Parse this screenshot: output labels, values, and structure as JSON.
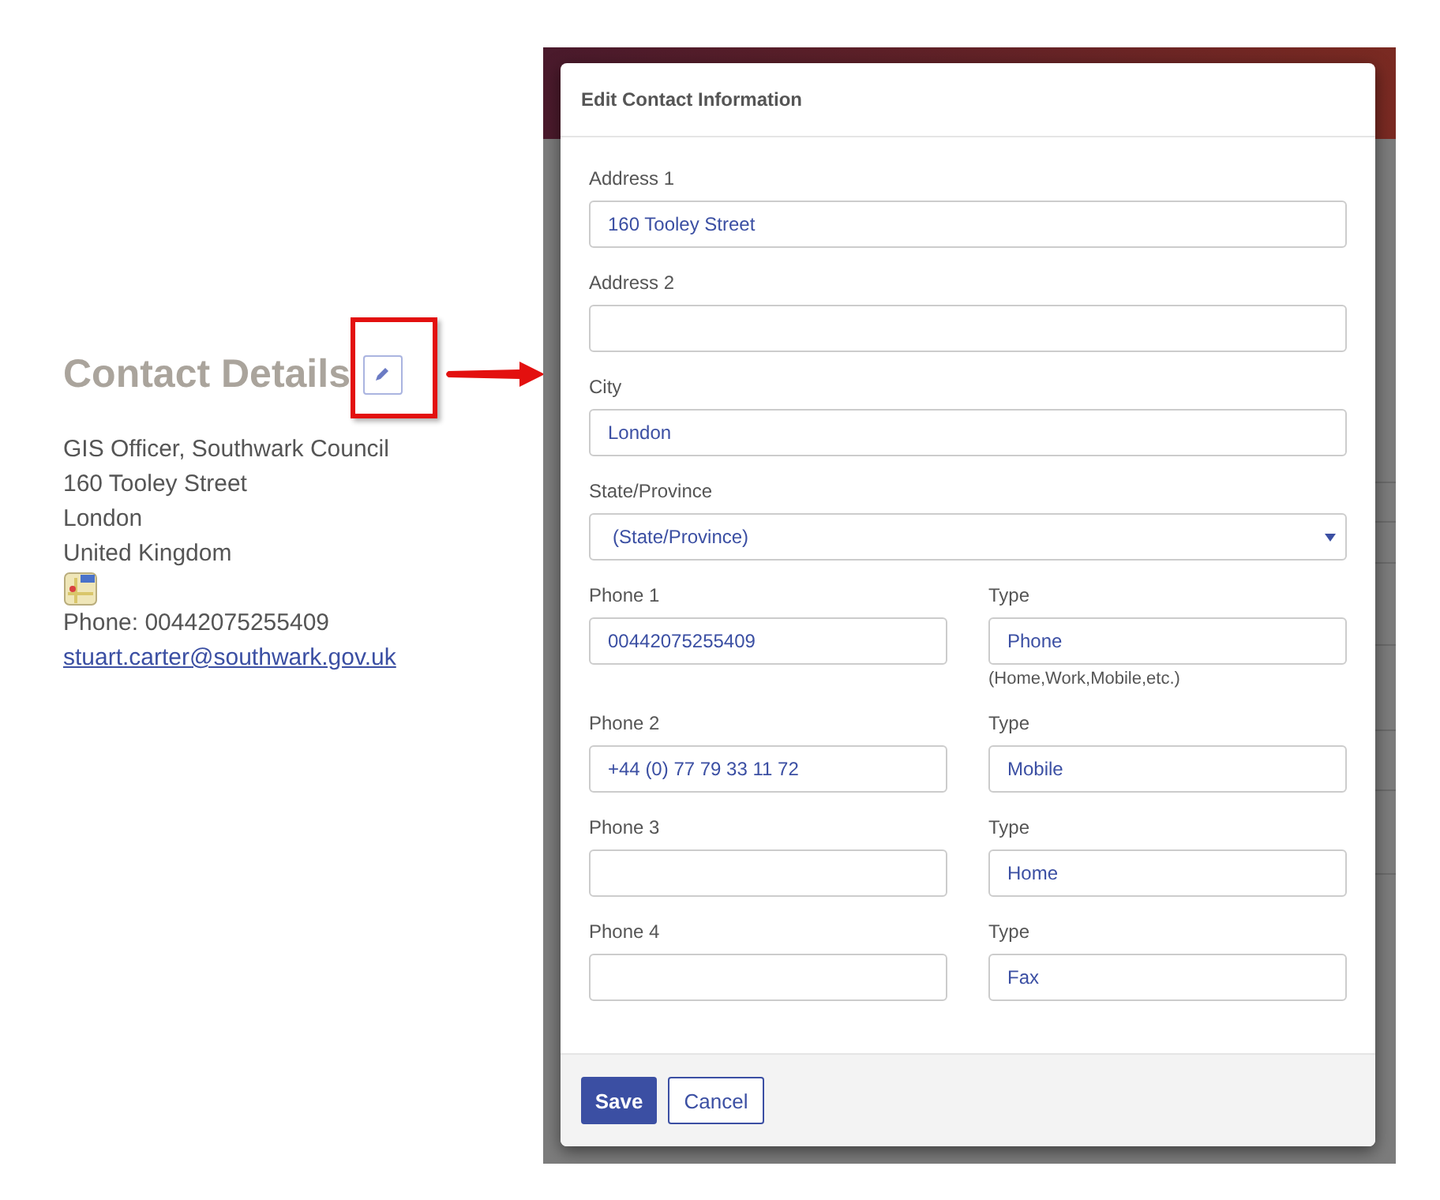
{
  "contact_details": {
    "title": "Contact Details",
    "lines": [
      "GIS Officer, Southwark Council",
      "160 Tooley Street",
      "London",
      "United Kingdom"
    ],
    "phone": "Phone: 00442075255409",
    "email": "stuart.carter@southwark.gov.uk"
  },
  "dialog": {
    "title": "Edit Contact Information",
    "rows": [
      [
        {
          "label": "Address 1",
          "kind": "text",
          "value": "160 Tooley Street"
        }
      ],
      [
        {
          "label": "Address 2",
          "kind": "text"
        }
      ],
      [
        {
          "label": "City",
          "kind": "text",
          "value": "London"
        }
      ],
      [
        {
          "label": "State/Province",
          "kind": "select",
          "value": "(State/Province)"
        }
      ],
      [
        {
          "label": "Phone 1",
          "kind": "text",
          "value": "00442075255409"
        },
        {
          "label": "Type",
          "kind": "text",
          "value": "Phone",
          "hint": "(Home,Work,Mobile,etc.)"
        }
      ],
      [
        {
          "label": "Phone 2",
          "kind": "text",
          "value": "+44 (0) 77 79 33 11 72"
        },
        {
          "label": "Type",
          "kind": "text",
          "value": "Mobile"
        }
      ],
      [
        {
          "label": "Phone 3",
          "kind": "text"
        },
        {
          "label": "Type",
          "kind": "text",
          "value": "Home"
        }
      ],
      [
        {
          "label": "Phone 4",
          "kind": "text"
        },
        {
          "label": "Type",
          "kind": "text",
          "value": "Fax"
        }
      ]
    ],
    "buttons": [
      {
        "label": "Save",
        "kind": "primary"
      },
      {
        "label": "Cancel",
        "kind": "secondary"
      }
    ]
  }
}
